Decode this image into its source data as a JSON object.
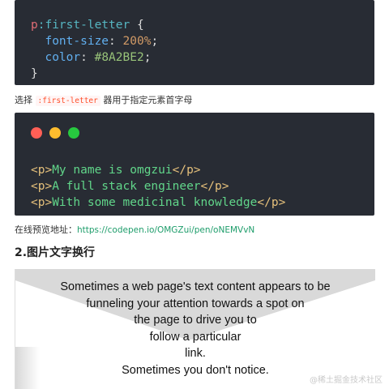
{
  "code_block_1": {
    "selector": "p",
    "pseudo": ":first-letter",
    "open_brace": " {",
    "line2_prop": "font-size",
    "line2_value": "200%",
    "line3_prop": "color",
    "line3_value": "#8A2BE2",
    "close_brace": "}"
  },
  "caption_1": {
    "prefix": "选择 ",
    "code": ":first-letter",
    "suffix": " 器用于指定元素首字母"
  },
  "code_block_2": {
    "window_dots": [
      "#ff5f56",
      "#ffbd2e",
      "#27c93f"
    ],
    "lines": [
      {
        "open": "<p>",
        "text": "My name is omgzui",
        "close": "</p>"
      },
      {
        "open": "<p>",
        "text": "A full stack engineer",
        "close": "</p>"
      },
      {
        "open": "<p>",
        "text": "With some medicinal knowledge",
        "close": "</p>"
      }
    ]
  },
  "caption_2": {
    "label": "在线预览地址：",
    "link": "https://codepen.io/OMGZui/pen/oNEMVvN"
  },
  "section_heading": "2.图片文字换行",
  "demo": {
    "lines": [
      "Sometimes a web page's text content appears to be",
      "funneling your attention towards a spot on",
      "the page to drive you to",
      "follow a particular",
      "link.",
      "Sometimes you don't notice."
    ]
  },
  "watermark": "@稀土掘金技术社区"
}
